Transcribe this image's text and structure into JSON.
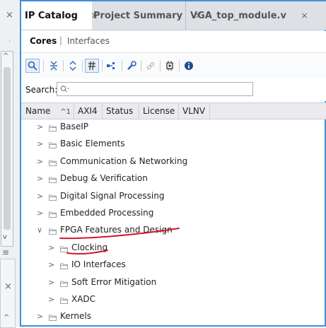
{
  "tabs": [
    {
      "label": "IP Catalog",
      "close": "×"
    },
    {
      "label": "Project Summary",
      "close": "×"
    },
    {
      "label": "VGA_top_module.v",
      "close": "×"
    }
  ],
  "subtabs": {
    "cores": "Cores",
    "separator": "|",
    "interfaces": "Interfaces"
  },
  "toolbar_icons": [
    "search-icon",
    "collapse-all-icon",
    "expand-all-icon",
    "filter-icon",
    "customize-ip-icon",
    "wrench-icon",
    "link-icon",
    "chip-icon",
    "info-icon"
  ],
  "search": {
    "label": "Search:",
    "placeholder": "Q·",
    "value": ""
  },
  "columns": [
    {
      "label": "Name",
      "sort_indicator": "^1"
    },
    {
      "label": "AXI4"
    },
    {
      "label": "Status"
    },
    {
      "label": "License"
    },
    {
      "label": "VLNV"
    }
  ],
  "tree": [
    {
      "label": "BaseIP",
      "level": 0,
      "expanded": false
    },
    {
      "label": "Basic Elements",
      "level": 0,
      "expanded": false
    },
    {
      "label": "Communication & Networking",
      "level": 0,
      "expanded": false
    },
    {
      "label": "Debug & Verification",
      "level": 0,
      "expanded": false
    },
    {
      "label": "Digital Signal Processing",
      "level": 0,
      "expanded": false
    },
    {
      "label": "Embedded Processing",
      "level": 0,
      "expanded": false
    },
    {
      "label": "FPGA Features and Design",
      "level": 0,
      "expanded": true
    },
    {
      "label": "Clocking",
      "level": 1,
      "expanded": false
    },
    {
      "label": "IO Interfaces",
      "level": 1,
      "expanded": false
    },
    {
      "label": "Soft Error Mitigation",
      "level": 1,
      "expanded": false
    },
    {
      "label": "XADC",
      "level": 1,
      "expanded": false
    },
    {
      "label": "Kernels",
      "level": 0,
      "expanded": false
    }
  ],
  "colors": {
    "accent": "#3f8fdc",
    "annotation": "#d0162a",
    "folder": "#9aa3ad"
  }
}
